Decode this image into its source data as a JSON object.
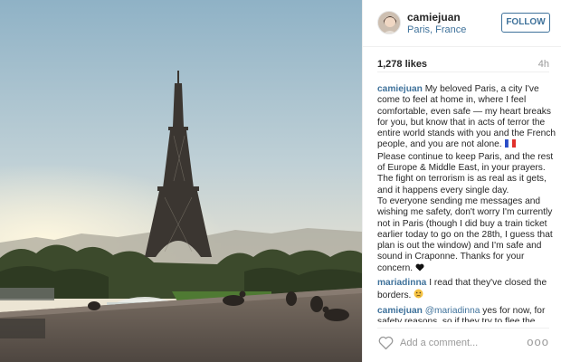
{
  "post": {
    "username": "camiejuan",
    "location": "Paris, France",
    "follow_label": "FOLLOW",
    "likes": "1,278 likes",
    "time": "4h"
  },
  "comments": [
    {
      "user": "camiejuan",
      "text1": "My beloved Paris, a city I've come to feel at home in, where I feel comfortable, even safe — my heart breaks for you, but know that in acts of terror the entire world stands with you and the French people, and you are not alone.",
      "text2": "Please continue to keep Paris, and the rest of Europe & Middle East, in your prayers. The fight on terrorism is as real as it gets, and it happens every single day.",
      "text3": "To everyone sending me messages and wishing me safety, don't worry I'm currently not in Paris (though I did buy a train ticket earlier today to go on the 28th, I guess that plan is out the window) and I'm safe and sound in Craponne. Thanks for your concern."
    },
    {
      "user": "mariadinna",
      "text": "I read that they've closed the borders."
    },
    {
      "user": "camiejuan",
      "mention": "@mariadinna",
      "text": "yes for now, for safety reasons, so if they try to flee the country they won't get far"
    }
  ],
  "comment_box": {
    "placeholder": "Add a comment..."
  },
  "more_label": "ooo",
  "icons": {
    "flag": "france-flag-icon",
    "heart_black": "black-heart-icon",
    "sad": "sad-face-icon",
    "like": "heart-outline-icon"
  },
  "colors": {
    "link": "#3f729b",
    "text": "#262626",
    "muted": "#999999"
  }
}
